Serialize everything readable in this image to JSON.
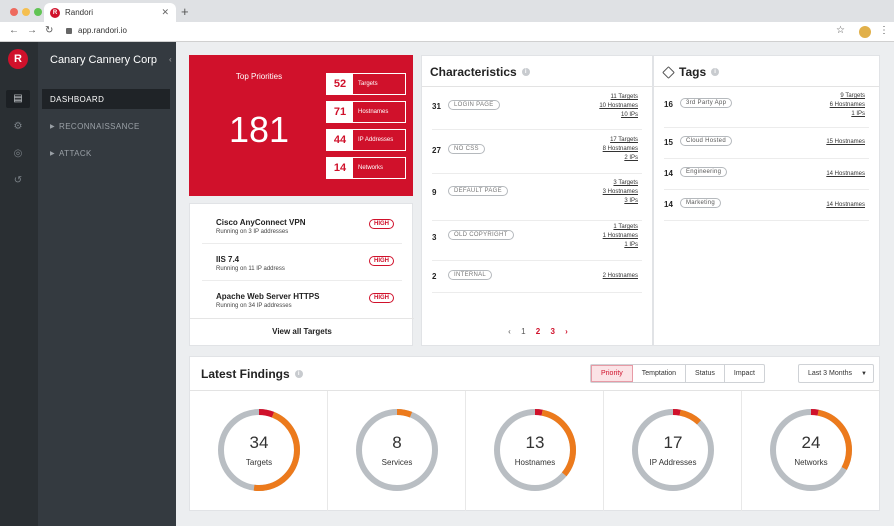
{
  "browser": {
    "tab_title": "Randori",
    "tab_favicon": "R",
    "url": "app.randori.io",
    "colors": {
      "dot_red": "#ee6a5e",
      "dot_yellow": "#f5bf4f",
      "dot_green": "#61c454"
    }
  },
  "app": {
    "logo_letter": "R",
    "org_name": "Canary Cannery Corp",
    "accent": "#d0112b",
    "rail_icons": [
      "dashboard-icon",
      "gear-icon",
      "target-icon",
      "history-icon"
    ],
    "nav": [
      {
        "label": "DASHBOARD",
        "active": true
      },
      {
        "label": "RECONNAISSANCE",
        "active": false
      },
      {
        "label": "ATTACK",
        "active": false
      }
    ]
  },
  "top_priorities": {
    "title": "Top Priorities",
    "total": "181",
    "rows": [
      {
        "count": "52",
        "label": "Targets"
      },
      {
        "count": "71",
        "label": "Hostnames"
      },
      {
        "count": "44",
        "label": "IP Addresses"
      },
      {
        "count": "14",
        "label": "Networks"
      }
    ]
  },
  "targets": {
    "rows": [
      {
        "name": "Cisco AnyConnect VPN",
        "sub": "Running on 3 IP addresses",
        "badge": "HIGH"
      },
      {
        "name": "IIS 7.4",
        "sub": "Running on 11 IP address",
        "badge": "HIGH"
      },
      {
        "name": "Apache Web Server HTTPS",
        "sub": "Running on 34 IP addresses",
        "badge": "HIGH"
      }
    ],
    "view_all": "View all Targets"
  },
  "characteristics": {
    "title": "Characteristics",
    "rows": [
      {
        "count": "31",
        "label": "LOGIN PAGE",
        "links": [
          "11 Targets",
          "10 Hostnames",
          "10 IPs"
        ]
      },
      {
        "count": "27",
        "label": "NO CSS",
        "links": [
          "17 Targets",
          "8 Hostnames",
          "2 IPs"
        ]
      },
      {
        "count": "9",
        "label": "DEFAULT PAGE",
        "links": [
          "3 Targets",
          "3 Hostnames",
          "3 IPs"
        ]
      },
      {
        "count": "3",
        "label": "OLD COPYRIGHT",
        "links": [
          "1 Targets",
          "1 Hostnames",
          "1 IPs"
        ]
      },
      {
        "count": "2",
        "label": "INTERNAL",
        "links": [
          "2 Hostnames"
        ]
      }
    ],
    "pager": {
      "prev": "‹",
      "pages": [
        "1",
        "2",
        "3"
      ],
      "next": "›"
    }
  },
  "tags": {
    "title": "Tags",
    "rows": [
      {
        "count": "16",
        "label": "3rd Party App",
        "links": [
          "9 Targets",
          "6 Hostnames",
          "1 IPs"
        ]
      },
      {
        "count": "15",
        "label": "Cloud Hosted",
        "links": [
          "15 Hostnames"
        ]
      },
      {
        "count": "14",
        "label": "Engineering",
        "links": [
          "14 Hostnames"
        ]
      },
      {
        "count": "14",
        "label": "Marketing",
        "links": [
          "14 Hostnames"
        ]
      }
    ]
  },
  "findings": {
    "title": "Latest Findings",
    "filters": [
      {
        "label": "Priority",
        "active": true
      },
      {
        "label": "Temptation",
        "active": false
      },
      {
        "label": "Status",
        "active": false
      },
      {
        "label": "Impact",
        "active": false
      }
    ],
    "range": "Last 3 Months",
    "gauges": [
      {
        "value": "34",
        "label": "Targets",
        "red": 0.06,
        "orange": 0.46
      },
      {
        "value": "8",
        "label": "Services",
        "red": 0.0,
        "orange": 0.06
      },
      {
        "value": "13",
        "label": "Hostnames",
        "red": 0.03,
        "orange": 0.33
      },
      {
        "value": "17",
        "label": "IP Addresses",
        "red": 0.03,
        "orange": 0.09
      },
      {
        "value": "24",
        "label": "Networks",
        "red": 0.03,
        "orange": 0.3
      }
    ],
    "colors": {
      "red": "#d0112b",
      "orange": "#ec7a1c",
      "track": "#b9bec3"
    }
  }
}
